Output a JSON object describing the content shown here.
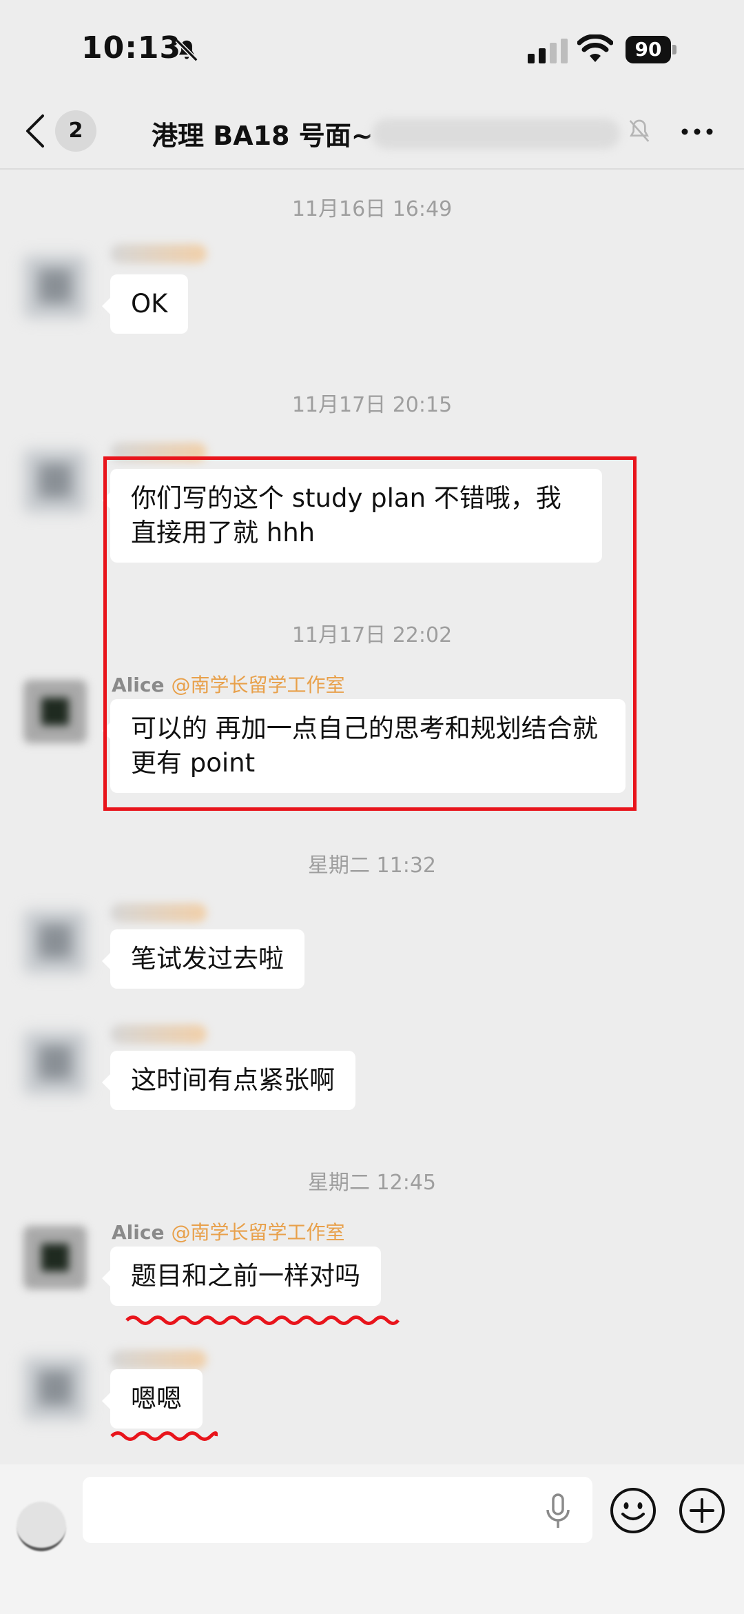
{
  "status_bar": {
    "time": "10:13",
    "battery": "90"
  },
  "header": {
    "unread_count": "2",
    "title": "港理 BA18 号面~"
  },
  "messages": {
    "ts1": "11月16日 16:49",
    "msg1": "OK",
    "ts2": "11月17日 20:15",
    "msg2": "你们写的这个 study plan 不错哦，我直接用了就 hhh",
    "ts3": "11月17日 22:02",
    "alice_name": "Alice",
    "alice_tag": "@南学长留学工作室",
    "msg3": "可以的 再加一点自己的思考和规划结合就更有 point",
    "ts4": "星期二 11:32",
    "msg4": "笔试发过去啦",
    "msg5": "这时间有点紧张啊",
    "ts5": "星期二 12:45",
    "msg6": "题目和之前一样对吗",
    "msg7": "嗯嗯"
  },
  "annotation": {
    "color": "#e8141b"
  },
  "icons": [
    "back-icon",
    "bell-off-icon",
    "signal-icon",
    "wifi-icon",
    "battery-icon",
    "more-icon",
    "mic-icon",
    "emoji-icon",
    "plus-icon"
  ]
}
